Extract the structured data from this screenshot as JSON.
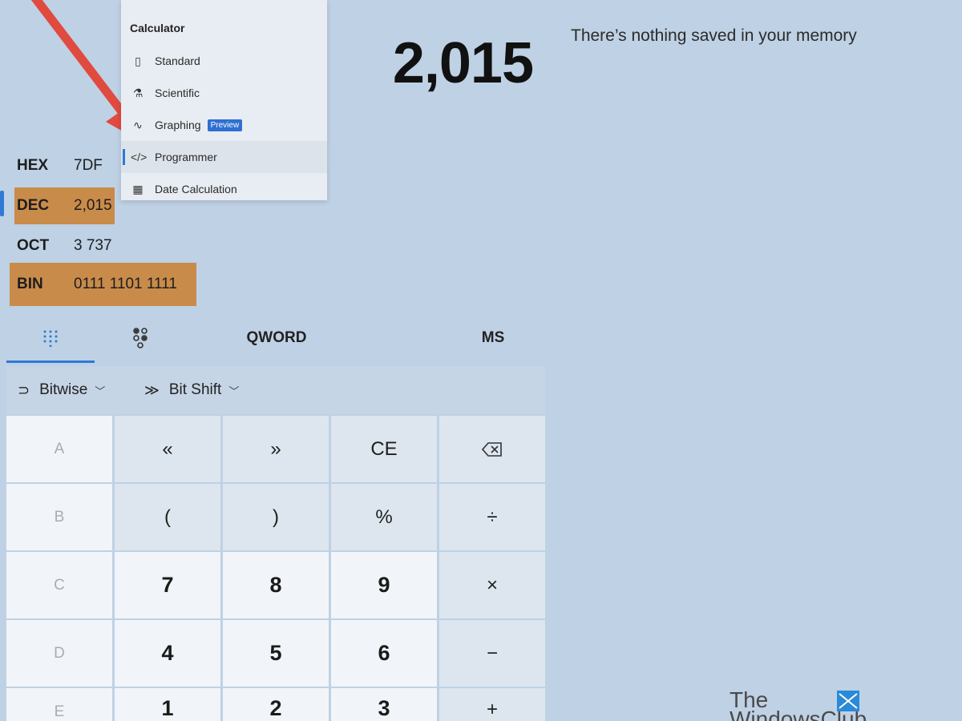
{
  "display": {
    "value": "2,015"
  },
  "memory": {
    "empty_message": "There’s nothing saved in your memory"
  },
  "radix": [
    {
      "label": "HEX",
      "value": "7DF",
      "highlighted": false
    },
    {
      "label": "DEC",
      "value": "2,015",
      "highlighted": true
    },
    {
      "label": "OCT",
      "value": "3 737",
      "highlighted": false
    },
    {
      "label": "BIN",
      "value": "0111 1101 1111",
      "highlighted": true
    }
  ],
  "nav": {
    "title": "Calculator",
    "items": [
      {
        "label": "Standard",
        "icon": "standard-icon"
      },
      {
        "label": "Scientific",
        "icon": "flask-icon"
      },
      {
        "label": "Graphing",
        "icon": "graph-icon",
        "badge": "Preview"
      },
      {
        "label": "Programmer",
        "icon": "code-icon",
        "active": true
      },
      {
        "label": "Date Calculation",
        "icon": "calendar-icon"
      }
    ]
  },
  "tabs": {
    "word_size": "QWORD",
    "memory_store": "MS"
  },
  "toolbar": {
    "bitwise": "Bitwise",
    "bitshift": "Bit Shift"
  },
  "keys": {
    "row1": [
      "A",
      "«",
      "»",
      "CE",
      "⌫"
    ],
    "row2": [
      "B",
      "(",
      ")",
      "%",
      "÷"
    ],
    "row3": [
      "C",
      "7",
      "8",
      "9",
      "×"
    ],
    "row4": [
      "D",
      "4",
      "5",
      "6",
      "−"
    ],
    "row5": [
      "E",
      "1",
      "2",
      "3",
      "+"
    ]
  },
  "watermark": {
    "line1": "The",
    "line2": "WindowsClub"
  },
  "colors": {
    "accent": "#2e7ad6",
    "highlight": "#c98b4a",
    "background": "#bfd1e4",
    "arrow": "#e04a3f"
  }
}
